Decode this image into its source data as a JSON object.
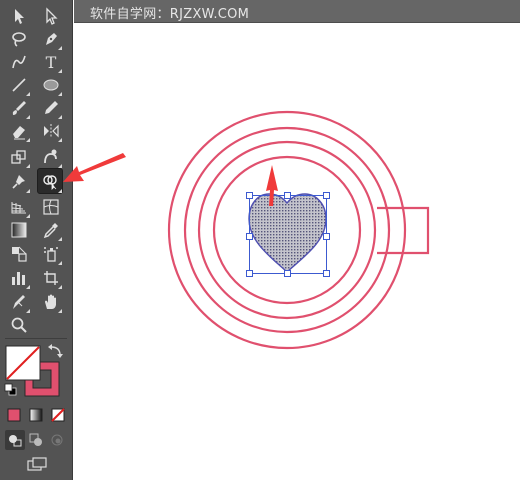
{
  "app": {
    "watermark_text": "软件自学网：RJZXW.COM"
  },
  "toolbar": {
    "tools": [
      {
        "name": "selection-tool",
        "icon": "selection-arrow-icon"
      },
      {
        "name": "direct-selection-tool",
        "icon": "direct-selection-arrow-icon"
      },
      {
        "name": "magic-wand-tool",
        "icon": "magic-wand-icon"
      },
      {
        "name": "pen-tool",
        "icon": "pen-icon"
      },
      {
        "name": "curvature-tool",
        "icon": "curvature-icon"
      },
      {
        "name": "type-tool",
        "icon": "type-icon",
        "label": "T"
      },
      {
        "name": "line-segment-tool",
        "icon": "line-icon"
      },
      {
        "name": "ellipse-tool",
        "icon": "ellipse-icon"
      },
      {
        "name": "paintbrush-tool",
        "icon": "paintbrush-icon"
      },
      {
        "name": "pencil-tool",
        "icon": "pencil-icon"
      },
      {
        "name": "eraser-tool",
        "icon": "eraser-icon"
      },
      {
        "name": "reflect-tool",
        "icon": "reflect-icon"
      },
      {
        "name": "scale-tool",
        "icon": "scale-icon"
      },
      {
        "name": "warp-tool",
        "icon": "warp-icon"
      },
      {
        "name": "puppet-warp-tool",
        "icon": "pushpin-icon"
      },
      {
        "name": "shape-builder-tool",
        "icon": "shape-builder-icon",
        "selected": true
      },
      {
        "name": "perspective-grid-tool",
        "icon": "perspective-grid-icon"
      },
      {
        "name": "mesh-tool",
        "icon": "mesh-icon"
      },
      {
        "name": "gradient-tool",
        "icon": "gradient-icon"
      },
      {
        "name": "eyedropper-tool",
        "icon": "eyedropper-icon"
      },
      {
        "name": "blend-tool",
        "icon": "blend-icon"
      },
      {
        "name": "symbol-sprayer-tool",
        "icon": "symbol-sprayer-icon"
      },
      {
        "name": "column-graph-tool",
        "icon": "column-graph-icon"
      },
      {
        "name": "artboard-tool",
        "icon": "artboard-icon"
      },
      {
        "name": "slice-tool",
        "icon": "slice-icon"
      },
      {
        "name": "hand-tool",
        "icon": "hand-icon"
      },
      {
        "name": "zoom-tool",
        "icon": "zoom-icon"
      }
    ],
    "fill_color": "none",
    "stroke_color": "#e0506e",
    "swap_icon": "swap-arrows-icon",
    "default_colors_icon": "default-colors-icon",
    "color_modes": [
      "color-mode-icon",
      "gradient-mode-icon",
      "none-mode-icon"
    ],
    "draw_modes": [
      "draw-normal-icon",
      "draw-behind-icon",
      "draw-inside-icon"
    ],
    "screen_mode_icon": "screen-mode-icon"
  },
  "colors": {
    "toolbar_bg": "#535353",
    "ring_stroke": "#e0506e",
    "heart_fill": "#9a9aa6",
    "heart_outline": "#4f4fb0",
    "selection_blue": "#3c5ad0",
    "annotation_red": "#f03a3a"
  }
}
